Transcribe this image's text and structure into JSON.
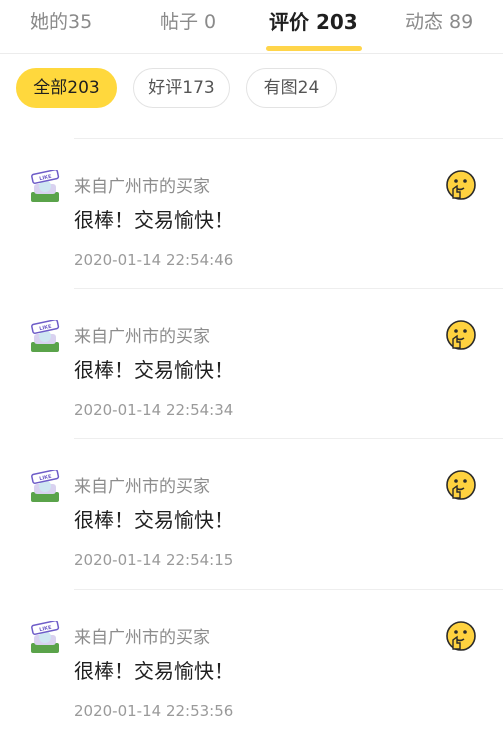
{
  "tabs": [
    {
      "label": "她的35"
    },
    {
      "label": "帖子 0"
    },
    {
      "label": "评价 203"
    },
    {
      "label": "动态 89"
    }
  ],
  "filters": [
    {
      "label": "全部203"
    },
    {
      "label": "好评173"
    },
    {
      "label": "有图24"
    }
  ],
  "reviews": [
    {
      "buyer": "来自广州市的买家",
      "comment": "很棒！交易愉快！",
      "time": "2020-01-14 22:54:46",
      "avatar_icon": "avatar-like-sign-icon",
      "rating_icon": "thumbs-up-emoji-icon"
    },
    {
      "buyer": "来自广州市的买家",
      "comment": "很棒！交易愉快！",
      "time": "2020-01-14 22:54:34",
      "avatar_icon": "avatar-like-sign-icon",
      "rating_icon": "thumbs-up-emoji-icon"
    },
    {
      "buyer": "来自广州市的买家",
      "comment": "很棒！交易愉快！",
      "time": "2020-01-14 22:54:15",
      "avatar_icon": "avatar-like-sign-icon",
      "rating_icon": "thumbs-up-emoji-icon"
    },
    {
      "buyer": "来自广州市的买家",
      "comment": "很棒！交易愉快！",
      "time": "2020-01-14 22:53:56",
      "avatar_icon": "avatar-like-sign-icon",
      "rating_icon": "thumbs-up-emoji-icon"
    }
  ],
  "colors": {
    "accent": "#ffd83d",
    "emoji": "#ffd23f"
  }
}
